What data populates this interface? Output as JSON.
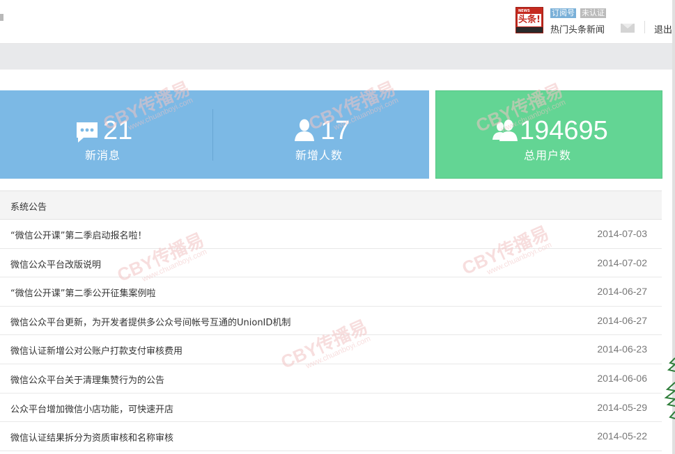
{
  "account": {
    "avatar_top": "NEWS",
    "avatar_main": "头条!",
    "subscription_badge": "订阅号",
    "verification_badge": "未认证",
    "name": "热门头条新闻",
    "logout_label": "退出"
  },
  "stats": {
    "messages": {
      "value": "21",
      "label": "新消息"
    },
    "new_users": {
      "value": "17",
      "label": "新增人数"
    },
    "total_users": {
      "value": "194695",
      "label": "总用户数"
    }
  },
  "notices": {
    "title": "系统公告",
    "items": [
      {
        "title": "“微信公开课”第二季启动报名啦！",
        "date": "2014-07-03"
      },
      {
        "title": "微信公众平台改版说明",
        "date": "2014-07-02"
      },
      {
        "title": "“微信公开课”第二季公开征集案例啦",
        "date": "2014-06-27"
      },
      {
        "title": "微信公众平台更新，为开发者提供多公众号间帐号互通的UnionID机制",
        "date": "2014-06-27"
      },
      {
        "title": "微信认证新增公对公账户打款支付审核费用",
        "date": "2014-06-23"
      },
      {
        "title": "微信公众平台关于清理集赞行为的公告",
        "date": "2014-06-06"
      },
      {
        "title": "公众平台增加微信小店功能，可快速开店",
        "date": "2014-05-29"
      },
      {
        "title": "微信认证结果拆分为资质审核和名称审核",
        "date": "2014-05-22"
      }
    ]
  },
  "watermark": {
    "text": "CBY传播易",
    "url": "www.chuanboyi.com"
  },
  "colors": {
    "blue_panel": "#7cb9e5",
    "green_panel": "#63d594",
    "header_band": "#e8e9eb"
  }
}
